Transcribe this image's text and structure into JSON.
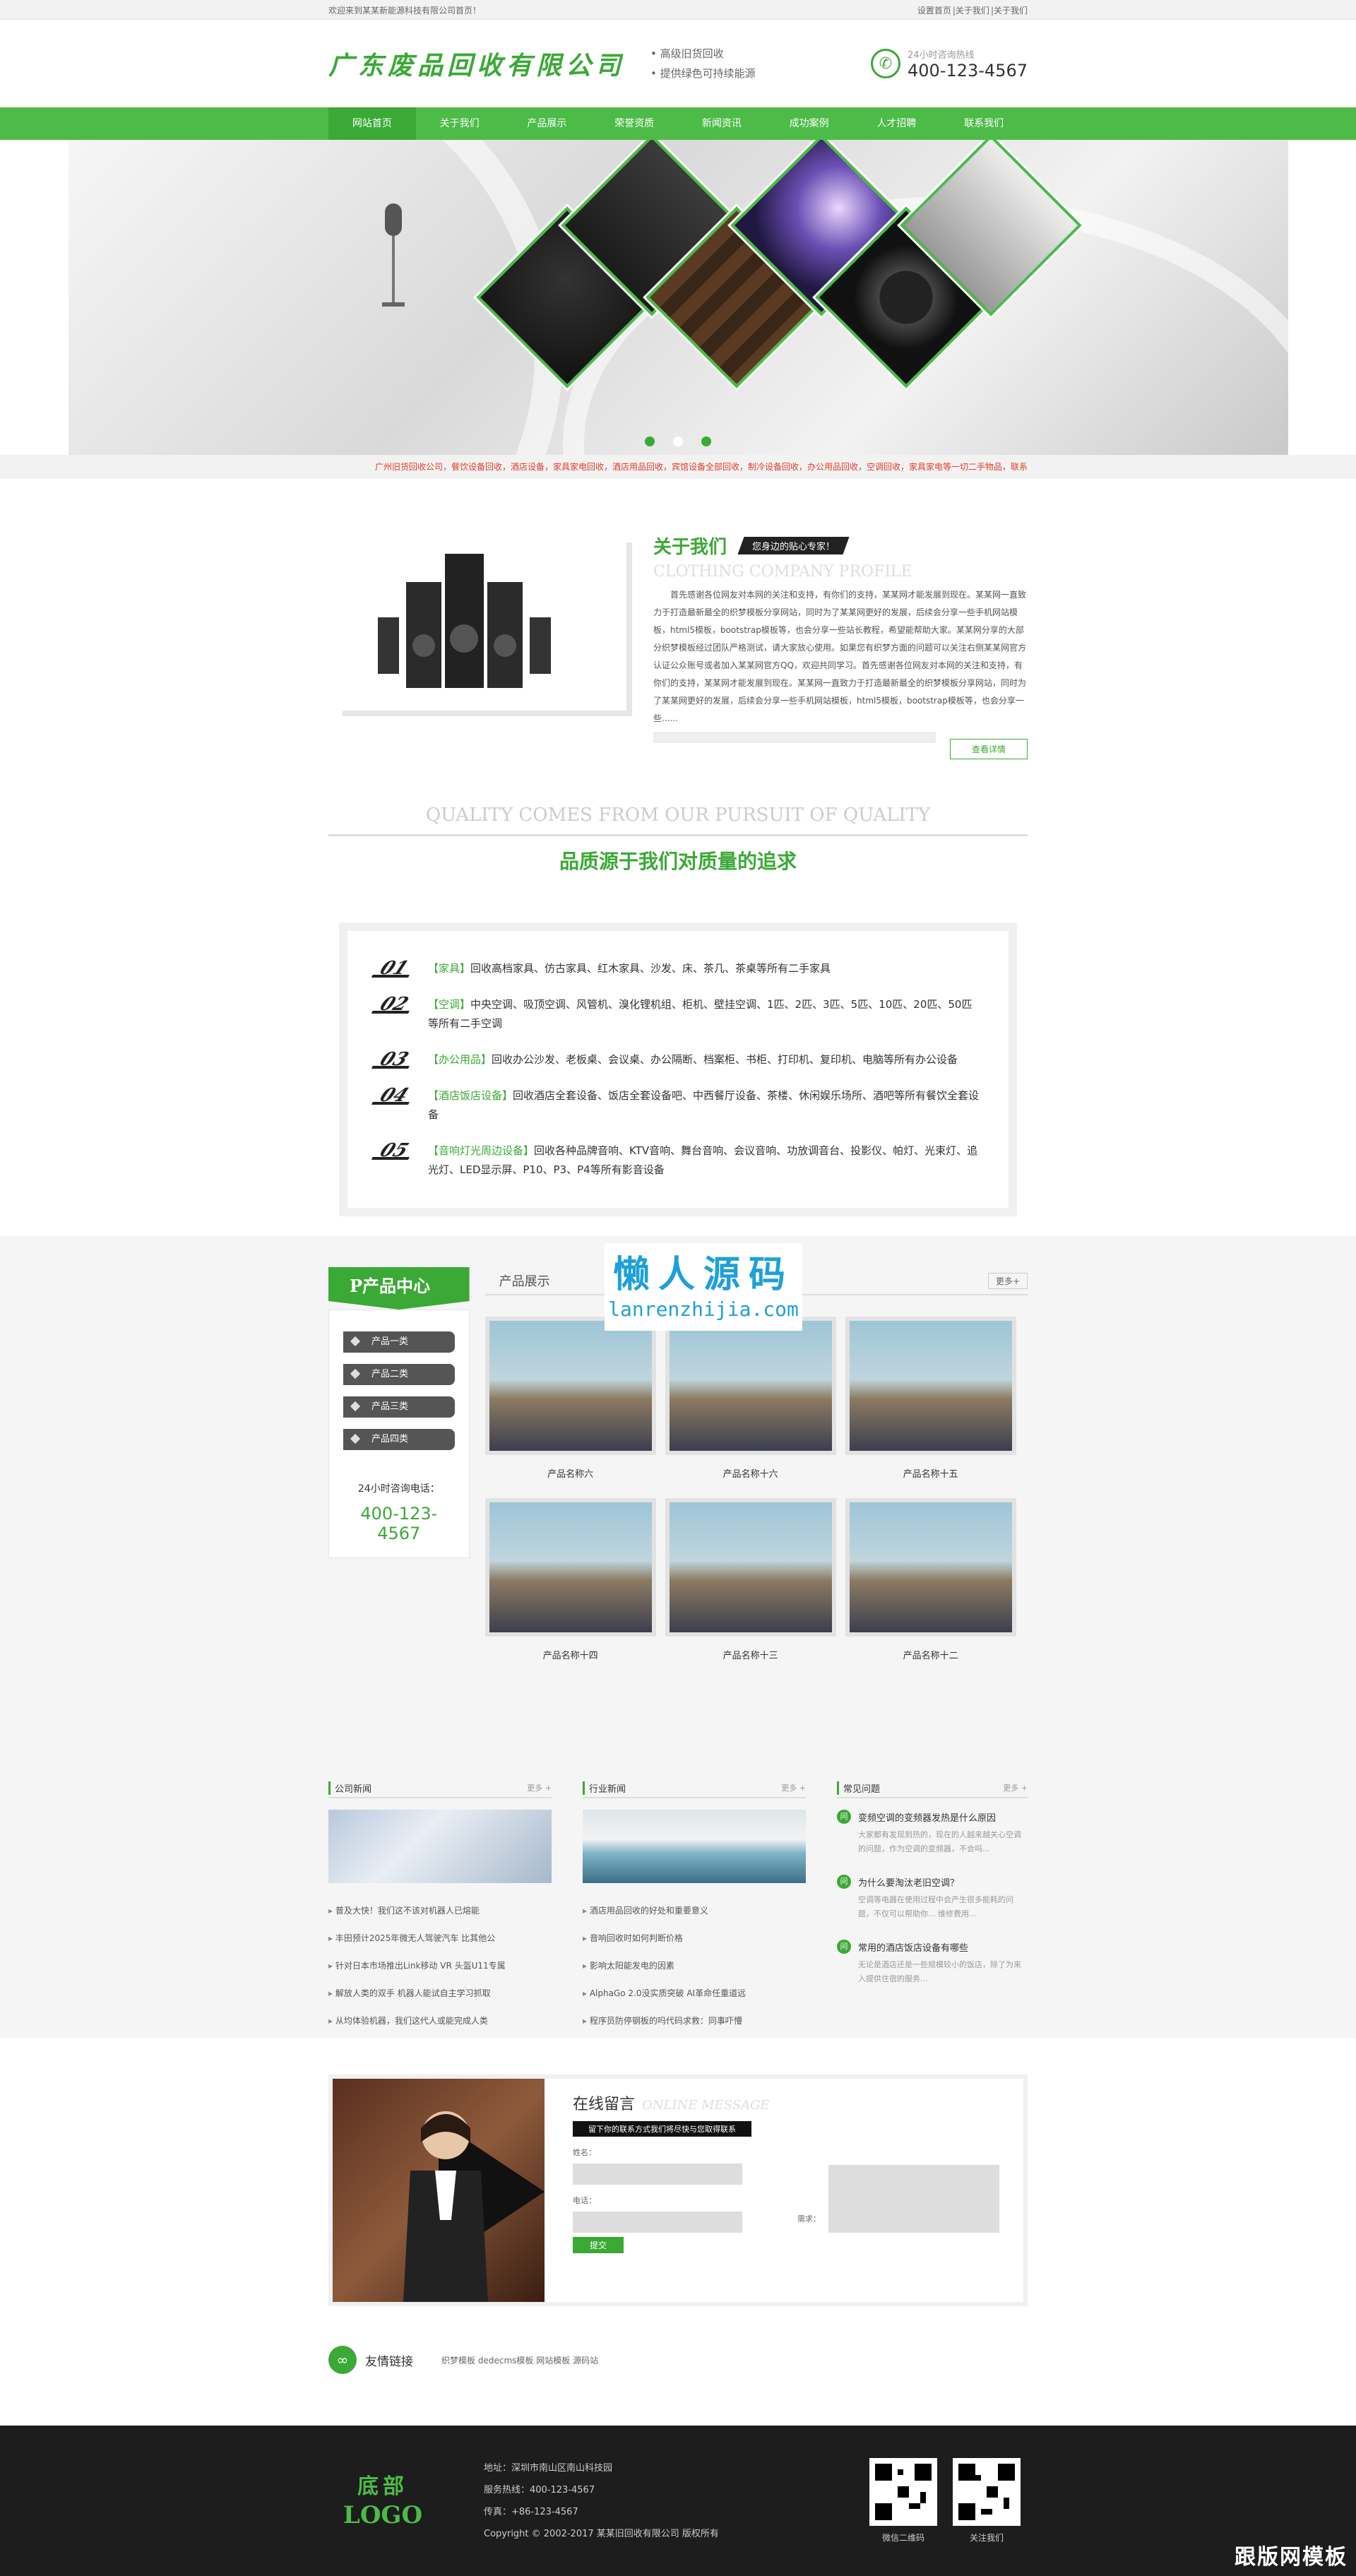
{
  "topbar": {
    "welcome": "欢迎来到某某新能源科技有限公司首页！",
    "links": [
      "设置首页",
      "|",
      "关于我们",
      "|",
      "关于我们"
    ]
  },
  "header": {
    "logo": "广东废品回收有限公司",
    "slogans": [
      "高级旧货回收",
      "提供绿色可持续能源"
    ],
    "hotline_label": "24小时咨询热线",
    "hotline": "400-123-4567"
  },
  "nav": [
    "网站首页",
    "关于我们",
    "产品展示",
    "荣誉资质",
    "新闻资讯",
    "成功案例",
    "人才招聘",
    "联系我们"
  ],
  "banner": {
    "dots": 3,
    "active_dot": 0
  },
  "ticker": "广州旧货回收公司，餐饮设备回收，酒店设备，家具家电回收，酒店用品回收，宾馆设备全部回收，制冷设备回收，办公用品回收，空调回收，家具家电等一切二手物品，联系",
  "about": {
    "title": "关于我们",
    "tag": "您身边的贴心专家！",
    "en": "CLOTHING COMPANY PROFILE",
    "text": "首先感谢各位网友对本网的关注和支持，有你们的支持，某某网才能发展到现在。某某网一直致力于打造最新最全的织梦模板分享网站，同时为了某某网更好的发展，后续会分享一些手机网站模板，html5模板，bootstrap模板等，也会分享一些站长教程，希望能帮助大家。某某网分享的大部分织梦模板经过团队严格测试，请大家放心使用。如果您有织梦方面的问题可以关注右侧某某网官方认证公众账号或者加入某某网官方QQ，欢迎共同学习。首先感谢各位网友对本网的关注和支持，有你们的支持，某某网才能发展到现在。某某网一直致力于打造最新最全的织梦模板分享网站，同时为了某某网更好的发展，后续会分享一些手机网站模板，html5模板，bootstrap模板等，也会分享一些......",
    "more": "查看详情"
  },
  "quality": {
    "en": "QUALITY COMES FROM OUR PURSUIT OF QUALITY",
    "cn": "品质源于我们对质量的追求",
    "items": [
      {
        "num": "01",
        "tag": "【家具】",
        "text": "回收高档家具、仿古家具、红木家具、沙发、床、茶几、茶桌等所有二手家具"
      },
      {
        "num": "02",
        "tag": "【空调】",
        "text": "中央空调、吸顶空调、风管机、溴化锂机组、柜机、壁挂空调、1匹、2匹、3匹、5匹、10匹、20匹、50匹等所有二手空调"
      },
      {
        "num": "03",
        "tag": "【办公用品】",
        "text": "回收办公沙发、老板桌、会议桌、办公隔断、档案柜、书柜、打印机、复印机、电脑等所有办公设备"
      },
      {
        "num": "04",
        "tag": "【酒店饭店设备】",
        "text": "回收酒店全套设备、饭店全套设备吧、中西餐厅设备、茶楼、休闲娱乐场所、酒吧等所有餐饮全套设备"
      },
      {
        "num": "05",
        "tag": "【音响灯光周边设备】",
        "text": "回收各种品牌音响、KTV音响、舞台音响、会议音响、功放调音台、投影仪、帕灯、光束灯、追光灯、LED显示屏、P10、P3、P4等所有影音设备"
      }
    ]
  },
  "products": {
    "side_title": "P产品中心",
    "categories": [
      "产品一类",
      "产品二类",
      "产品三类",
      "产品四类"
    ],
    "tel_label": "24小时咨询电话：",
    "tel": "400-123-4567",
    "head": "产品展示",
    "more": "更多+",
    "items": [
      "产品名称六",
      "产品名称十六",
      "产品名称十五",
      "产品名称十四",
      "产品名称十三",
      "产品名称十二"
    ]
  },
  "watermark": {
    "line1": "懒人源码",
    "line2": "lanrenzhijia.com"
  },
  "news": {
    "company": {
      "title": "公司新闻",
      "more": "更多 +",
      "items": [
        "普及大快！我们这不该对机器人已熔能",
        "丰田预计2025年微无人驾驶汽车 比其他公",
        "针对日本市场推出Link移动 VR 头盔U11专属",
        "解放人类的双手 机器人能试自主学习抓取",
        "从均体验机器，我们这代人或能完成人类"
      ]
    },
    "industry": {
      "title": "行业新闻",
      "more": "更多 +",
      "items": [
        "酒店用品回收的好处和重要意义",
        "音响回收时如何判断价格",
        "影响太阳能发电的因素",
        "AlphaGo 2.0没实质突破 AI革命任重道远",
        "程序员防停钢板的吗代码求救：同事吓懵"
      ]
    },
    "faq": {
      "title": "常见问题",
      "more": "更多 +",
      "items": [
        {
          "q": "变频空调的变频器发热是什么原因",
          "a": "大家都有发现到热的，现在的人越来越关心空调的问题，作为空调的变频器，不会吗..."
        },
        {
          "q": "为什么要淘汰老旧空调？",
          "a": "空调等电器在使用过程中会产生很多能耗的问题，不仅可以帮助你... 维修费用..."
        },
        {
          "q": "常用的酒店饭店设备有哪些",
          "a": "无论是酒店还是一些规模较小的饭店，除了为来入提供住宿的服务..."
        }
      ],
      "badge": "问"
    }
  },
  "message": {
    "title": "在线留言",
    "en": "ONLINE MESSAGE",
    "sub": "留下你的联系方式我们将尽快与您取得联系",
    "name_label": "姓名：",
    "phone_label": "电话：",
    "need_label": "需求：",
    "submit": "提交"
  },
  "friends": {
    "title": "友情链接",
    "links": [
      "织梦模板",
      "dedecms模板",
      "网站模板",
      "源码站"
    ]
  },
  "footer": {
    "logo1": "底部",
    "logo2": "LOGO",
    "address": "地址：深圳市南山区南山科技园",
    "hotline": "服务热线：400-123-4567",
    "fax": "传真：+86-123-4567",
    "copyright": "Copyright © 2002-2017 某某旧回收有限公司 版权所有",
    "qr1": "微信二维码",
    "qr2": "关注我们",
    "corner": "跟版网模板"
  },
  "colors": {
    "accent": "#3aa935",
    "nav": "#4cbb47",
    "footer": "#1d1d1d"
  }
}
